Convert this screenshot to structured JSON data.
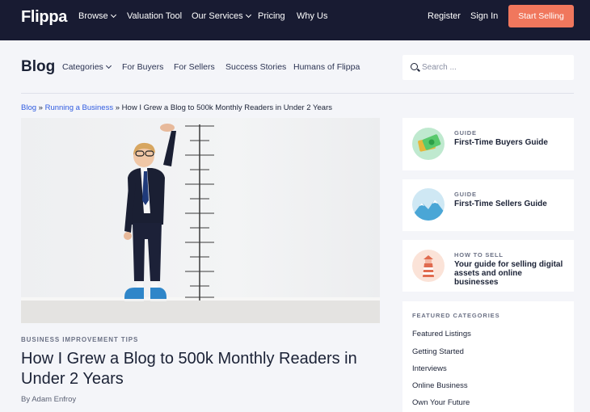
{
  "nav": {
    "logo": "Flippa",
    "items": [
      {
        "label": "Browse",
        "dropdown": true
      },
      {
        "label": "Valuation Tool",
        "dropdown": false
      },
      {
        "label": "Our Services",
        "dropdown": true
      },
      {
        "label": "Pricing",
        "dropdown": false
      },
      {
        "label": "Why Us",
        "dropdown": false
      }
    ],
    "register": "Register",
    "sign_in": "Sign In",
    "cta": "Start Selling"
  },
  "blog": {
    "title": "Blog",
    "nav": [
      {
        "label": "Categories",
        "dropdown": true
      },
      {
        "label": "For Buyers",
        "dropdown": false
      },
      {
        "label": "For Sellers",
        "dropdown": false
      },
      {
        "label": "Success Stories",
        "dropdown": false
      },
      {
        "label": "Humans of Flippa",
        "dropdown": false
      }
    ],
    "search_placeholder": "Search ..."
  },
  "breadcrumb": {
    "items": [
      "Blog",
      "Running a Business"
    ],
    "separator": "»",
    "current": "How I Grew a Blog to 500k Monthly Readers in Under 2 Years"
  },
  "article": {
    "category": "BUSINESS IMPROVEMENT TIPS",
    "title": "How I Grew a Blog to 500k Monthly Readers in Under 2 Years",
    "byline": "By Adam Enfroy"
  },
  "sidebar": {
    "cards": [
      {
        "kicker": "GUIDE",
        "title": "First-Time Buyers Guide",
        "icon": "money-icon"
      },
      {
        "kicker": "GUIDE",
        "title": "First-Time Sellers Guide",
        "icon": "mountain-icon"
      },
      {
        "kicker": "HOW TO SELL",
        "title": "Your guide for selling digital assets and online businesses",
        "icon": "lighthouse-icon"
      }
    ],
    "featured_heading": "FEATURED CATEGORIES",
    "featured": [
      "Featured Listings",
      "Getting Started",
      "Interviews",
      "Online Business",
      "Own Your Future"
    ]
  },
  "colors": {
    "nav_bg": "#181b32",
    "cta": "#f0775d",
    "link": "#2f5be0",
    "page_bg": "#f4f5f9"
  }
}
